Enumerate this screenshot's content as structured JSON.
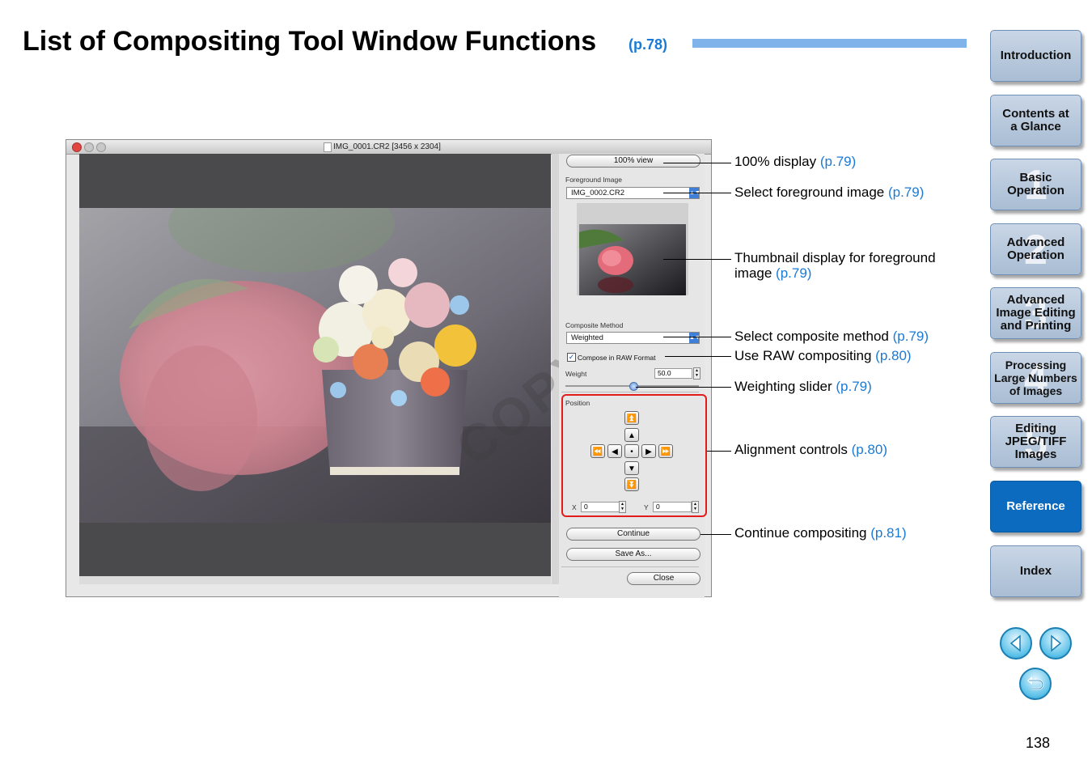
{
  "header": {
    "title": "List of Compositing Tool Window Functions",
    "title_ref": "(p.78)"
  },
  "nav": {
    "items": [
      {
        "label": "Introduction",
        "num": ""
      },
      {
        "label": "Contents at a Glance",
        "num": ""
      },
      {
        "label": "Basic Operation",
        "num": "1"
      },
      {
        "label": "Advanced Operation",
        "num": "2"
      },
      {
        "label": "Advanced Image Editing and Printing",
        "num": "3"
      },
      {
        "label": "Processing Large Numbers of Images",
        "num": "4"
      },
      {
        "label": "Editing JPEG/TIFF Images",
        "num": "5"
      },
      {
        "label": "Reference",
        "num": ""
      },
      {
        "label": "Index",
        "num": ""
      }
    ],
    "active": "Reference"
  },
  "window": {
    "title": "IMG_0001.CR2 [3456 x 2304]",
    "view_button": "100% view",
    "foreground_label": "Foreground Image",
    "foreground_value": "IMG_0002.CR2",
    "composite_method_label": "Composite Method",
    "composite_method_value": "Weighted",
    "raw_checkbox_label": "Compose in RAW Format",
    "raw_checked": true,
    "weight_label": "Weight",
    "weight_value": "50.0",
    "position_label": "Position",
    "x_label": "X",
    "x_value": "0",
    "y_label": "Y",
    "y_value": "0",
    "continue_button": "Continue",
    "save_as_button": "Save As...",
    "close_button": "Close",
    "watermark": "COPY"
  },
  "callouts": [
    {
      "text": "100% display",
      "ref": "(p.79)"
    },
    {
      "text": "Select foreground image",
      "ref": "(p.79)"
    },
    {
      "text": "Thumbnail display for foreground",
      "text2": "image",
      "ref": "(p.79)"
    },
    {
      "text": "Select composite method",
      "ref": "(p.79)"
    },
    {
      "text": "Use RAW compositing",
      "ref": "(p.80)"
    },
    {
      "text": "Weighting slider",
      "ref": "(p.79)"
    },
    {
      "text": "Alignment controls",
      "ref": "(p.80)"
    },
    {
      "text": "Continue compositing",
      "ref": "(p.81)"
    }
  ],
  "page_number": "138",
  "colors": {
    "accent_link": "#1a7ad6",
    "nav_active": "#0d6bbf",
    "highlight_border": "#e41b1b"
  },
  "icons": [
    "prev-page-icon",
    "next-page-icon",
    "return-icon"
  ]
}
